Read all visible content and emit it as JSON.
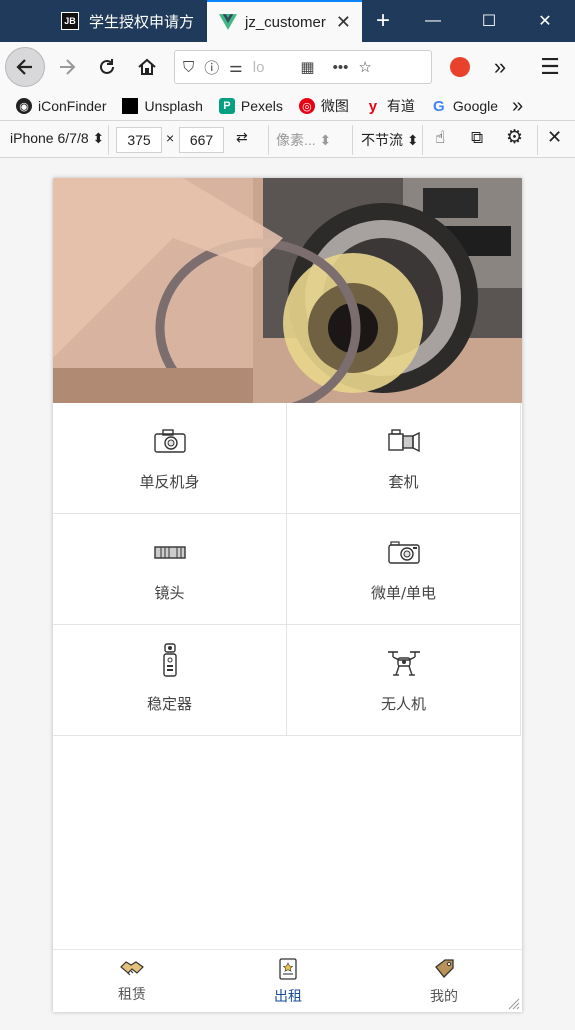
{
  "browser": {
    "tabs": [
      {
        "label": "学生授权申请方",
        "icon": "jetbrains-icon",
        "icon_text": "JB",
        "active": false
      },
      {
        "label": "jz_customer",
        "icon": "vue-logo-icon",
        "active": true
      }
    ],
    "url_text": "lo",
    "bookmarks": [
      {
        "label": "iConFinder",
        "icon": "iconfinder-icon"
      },
      {
        "label": "Unsplash",
        "icon": "unsplash-icon"
      },
      {
        "label": "Pexels",
        "icon": "pexels-icon",
        "icon_text": "P"
      },
      {
        "label": "微图",
        "icon": "weitu-icon"
      },
      {
        "label": "有道",
        "icon": "youdao-icon",
        "icon_text": "y"
      },
      {
        "label": "Google",
        "icon": "google-icon",
        "icon_text": "G"
      }
    ]
  },
  "responsive": {
    "device": "iPhone 6/7/8",
    "width": "375",
    "times": "×",
    "height": "667",
    "dpr_placeholder": "像素...",
    "throttle": "不节流"
  },
  "app": {
    "categories": [
      {
        "label": "单反机身",
        "icon": "dslr-camera-icon"
      },
      {
        "label": "套机",
        "icon": "camera-kit-icon"
      },
      {
        "label": "镜头",
        "icon": "lens-icon"
      },
      {
        "label": "微单/单电",
        "icon": "mirrorless-camera-icon"
      },
      {
        "label": "稳定器",
        "icon": "gimbal-icon"
      },
      {
        "label": "无人机",
        "icon": "drone-icon"
      }
    ],
    "tabbar": [
      {
        "label": "租赁",
        "icon": "handshake-icon",
        "active": false
      },
      {
        "label": "出租",
        "icon": "document-icon",
        "active": true
      },
      {
        "label": "我的",
        "icon": "tag-icon",
        "active": false
      }
    ],
    "colors": {
      "active_tab": "#1a4f9c",
      "accent": "#0a84ff"
    }
  }
}
